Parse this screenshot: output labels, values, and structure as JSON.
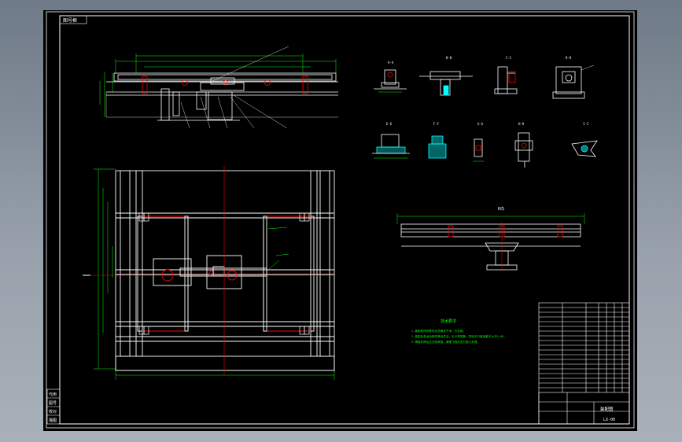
{
  "sheet": {
    "top_left_tag": "图号框",
    "title_block_name": "装配图",
    "title_block_code": "LX-00",
    "side_block": [
      "代用",
      "图号",
      "校对",
      "描图"
    ]
  },
  "views": {
    "elevation_label": "",
    "plan_label": "",
    "section_labels": [
      "A-A",
      "B-B",
      "C-C",
      "D-D",
      "E-E",
      "F-F",
      "G-G",
      "H-H",
      "I-I",
      "J-J"
    ],
    "side_view_label": "K向"
  },
  "notes": {
    "heading": "技术要求",
    "lines": [
      "1.装配前所有零件必须清洗干净，去毛刺。",
      "2.装配后各运动部件移动灵活，无卡滞现象，导轨平行度误差不大于0.05。",
      "3.焊接件焊后应去除焊渣，清理飞溅并进行退火处理。"
    ]
  },
  "colors": {
    "background": "#000000",
    "outline": "#ffffff",
    "dimension": "#00ff00",
    "center_line": "#ff0000",
    "hatch": "#00ffff",
    "text": "#ffff00"
  }
}
